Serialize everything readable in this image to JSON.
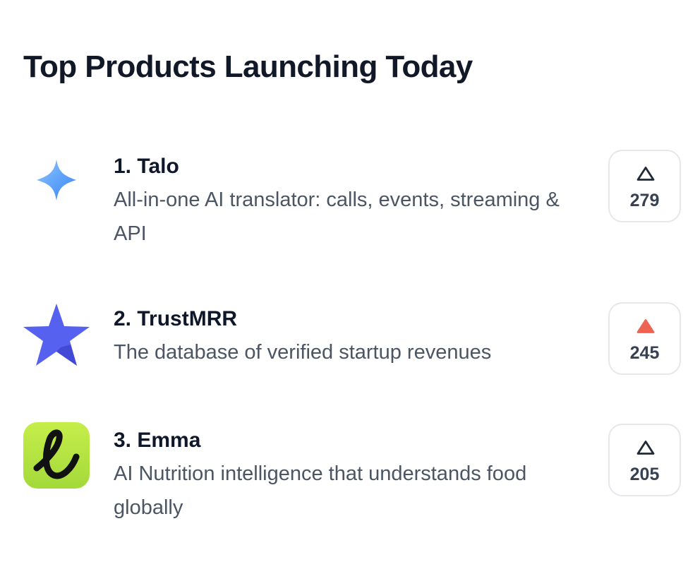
{
  "page": {
    "title": "Top Products Launching Today"
  },
  "products": [
    {
      "name": "1. Talo",
      "tagline": "All-in-one AI translator: calls, events, streaming & API",
      "votes": "279",
      "upvoted": false,
      "logo_icon": "blue-sparkle-icon"
    },
    {
      "name": "2. TrustMRR",
      "tagline": "The database of verified startup revenues",
      "votes": "245",
      "upvoted": true,
      "logo_icon": "blue-star-icon"
    },
    {
      "name": "3. Emma",
      "tagline": "AI Nutrition intelligence that understands food globally",
      "votes": "205",
      "upvoted": false,
      "logo_icon": "green-e-letter-icon"
    }
  ],
  "colors": {
    "upvote_active": "#ef6352",
    "upvote_inactive": "#1f2937",
    "border": "#e5e7eb",
    "tagline": "#4b5563",
    "title": "#111827"
  }
}
